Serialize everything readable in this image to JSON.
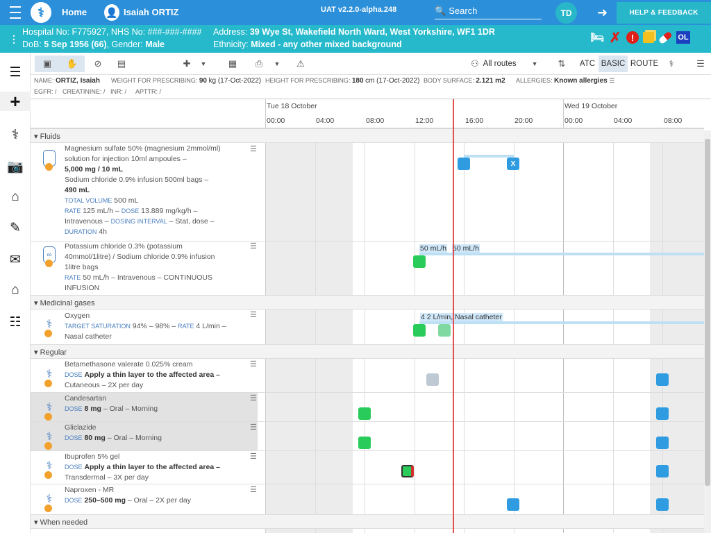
{
  "topbar": {
    "home": "Home",
    "patient_name": "Isaiah ORTIZ",
    "version": "UAT v2.2.0-alpha.248",
    "search_placeholder": "Search",
    "user_initials": "TD",
    "help": "HELP & FEEDBACK"
  },
  "banner": {
    "line1": "Hospital No: F775927, NHS No: ###-###-####",
    "line2_dob": "DoB: ",
    "line2_dob_val": "5 Sep 1956 (66)",
    "line2_gender": ", Gender: ",
    "line2_gender_val": "Male",
    "addr_label": "Address: ",
    "addr_val": "39 Wye St, Wakefield North Ward, West Yorkshire, WF1 1DR",
    "eth_label": "Ethnicity: ",
    "eth_val": "Mixed - any other mixed background",
    "flag_ol": "OL"
  },
  "toolbar": {
    "routes": "All routes",
    "atc": "ATC",
    "basic": "BASIC",
    "route": "ROUTE"
  },
  "info": {
    "name_k": "NAME:",
    "name_v": "ORTIZ, Isaiah",
    "weight_k": "WEIGHT FOR PRESCRIBING:",
    "weight_v": "90",
    "weight_u": "kg (17-Oct-2022)",
    "height_k": "HEIGHT FOR PRESCRIBING:",
    "height_v": "180",
    "height_u": "cm (17-Oct-2022)",
    "bsa_k": "BODY SURFACE:",
    "bsa_v": "2.121 m2",
    "allergies_k": "ALLERGIES:",
    "allergies_v": "Known allergies",
    "egfr": "EGFR: /",
    "creat": "CREATININE: /",
    "inr": "INR: /",
    "apttr": "APTTR: /"
  },
  "timeline": {
    "day1": "Tue 18 October",
    "day2": "Wed 19 October",
    "ticks": [
      "00:00",
      "04:00",
      "08:00",
      "12:00",
      "16:00",
      "20:00",
      "00:00",
      "04:00",
      "08:00"
    ]
  },
  "sections": {
    "fluids": "Fluids",
    "gases": "Medicinal gases",
    "regular": "Regular",
    "when_needed": "When needed"
  },
  "meds": {
    "mag_l1": "Magnesium sulfate 50% (magnesium 2mmol/ml)",
    "mag_l2": "solution for injection 10ml ampoules –",
    "mag_l3": "5,000 mg / 10 mL",
    "mag_l4": "Sodium chloride 0.9% infusion 500ml bags –",
    "mag_l5": "490 mL",
    "mag_tv_k": "TOTAL VOLUME",
    "mag_tv_v": "500 mL",
    "mag_rate_k": "RATE",
    "mag_rate_v": "125 mL/h –",
    "mag_dose_k": "DOSE",
    "mag_dose_v": "13.889 mg/kg/h –",
    "mag_l7a": "Intravenous –",
    "mag_di_k": "DOSING INTERVAL",
    "mag_l7b": "– Stat, dose –",
    "mag_dur_k": "DURATION",
    "mag_dur_v": "4h",
    "pot_l1": "Potassium chloride 0.3% (potassium",
    "pot_l2": "40mmol/1litre) / Sodium chloride 0.9% infusion",
    "pot_l3": "1litre bags",
    "pot_rate_k": "RATE",
    "pot_rate_v": "50 mL/h – Intravenous – CONTINUOUS",
    "pot_l5": "INFUSION",
    "oxy_l1": "Oxygen",
    "oxy_ts_k": "TARGET SATURATION",
    "oxy_ts_v": "94% – 98% –",
    "oxy_rate_k": "RATE",
    "oxy_rate_v": "4 L/min –",
    "oxy_l3": "Nasal catheter",
    "beta_l1": "Betamethasone valerate 0.025% cream",
    "beta_dose_k": "DOSE",
    "beta_dose_v": "Apply a thin layer to the affected area –",
    "beta_l3": "Cutaneous – 2X per day",
    "cand_l1": "Candesartan",
    "cand_dose_k": "DOSE",
    "cand_dose_v": "8 mg",
    "cand_rest": "– Oral – Morning",
    "glic_l1": "Gliclazide",
    "glic_dose_k": "DOSE",
    "glic_dose_v": "80 mg",
    "glic_rest": "– Oral – Morning",
    "ibu_l1": "Ibuprofen 5% gel",
    "ibu_dose_k": "DOSE",
    "ibu_dose_v": "Apply a thin layer to the affected area –",
    "ibu_l3": "Transdermal – 3X per day",
    "nap_l1": "Naproxen - MR",
    "nap_dose_k": "DOSE",
    "nap_dose_v": "250–500 mg",
    "nap_rest": "– Oral – 2X per day"
  },
  "chart_labels": {
    "pot_rate1": "50 mL/h",
    "pot_rate2": "50 mL/h",
    "oxy_rate": "4 2 L/min, Nasal catheter",
    "x_mark": "X"
  }
}
